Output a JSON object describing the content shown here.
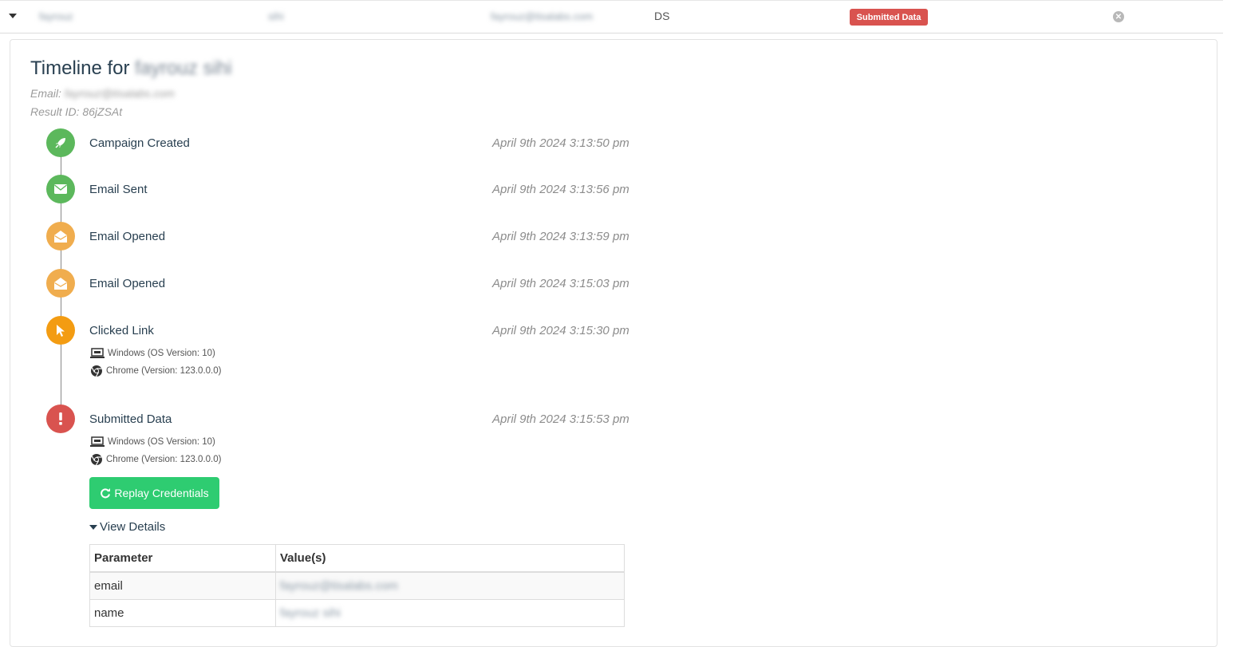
{
  "row": {
    "first_name": "fayrouz",
    "last_name": "sihi",
    "email": "fayrouz@tisalabs.com",
    "position": "DS",
    "status": "Submitted Data",
    "status_color": "#d9534f"
  },
  "panel": {
    "title_prefix": "Timeline for",
    "title_name": "fayrouz sihi",
    "email_label": "Email:",
    "email_value": "fayrouz@tisalabs.com",
    "result_label": "Result ID:",
    "result_value": "86jZSAt"
  },
  "events": [
    {
      "label": "Campaign Created",
      "time": "April 9th 2024 3:13:50 pm",
      "icon": "rocket-icon",
      "color": "#5cb85c"
    },
    {
      "label": "Email Sent",
      "time": "April 9th 2024 3:13:56 pm",
      "icon": "envelope-icon",
      "color": "#5cb85c"
    },
    {
      "label": "Email Opened",
      "time": "April 9th 2024 3:13:59 pm",
      "icon": "envelope-open-icon",
      "color": "#f0ad4e"
    },
    {
      "label": "Email Opened",
      "time": "April 9th 2024 3:15:03 pm",
      "icon": "envelope-open-icon",
      "color": "#f0ad4e"
    },
    {
      "label": "Clicked Link",
      "time": "April 9th 2024 3:15:30 pm",
      "icon": "mouse-pointer-icon",
      "color": "#f39c12",
      "os": "Windows (OS Version: 10)",
      "browser": "Chrome (Version: 123.0.0.0)"
    },
    {
      "label": "Submitted Data",
      "time": "April 9th 2024 3:15:53 pm",
      "icon": "exclamation-icon",
      "color": "#d9534f",
      "os": "Windows (OS Version: 10)",
      "browser": "Chrome (Version: 123.0.0.0)"
    }
  ],
  "replay_button": "Replay Credentials",
  "view_details": "View Details",
  "table": {
    "headers": [
      "Parameter",
      "Value(s)"
    ],
    "rows": [
      {
        "param": "email",
        "value": "fayrouz@tisalabs.com"
      },
      {
        "param": "name",
        "value": "fayrouz sihi"
      }
    ]
  }
}
